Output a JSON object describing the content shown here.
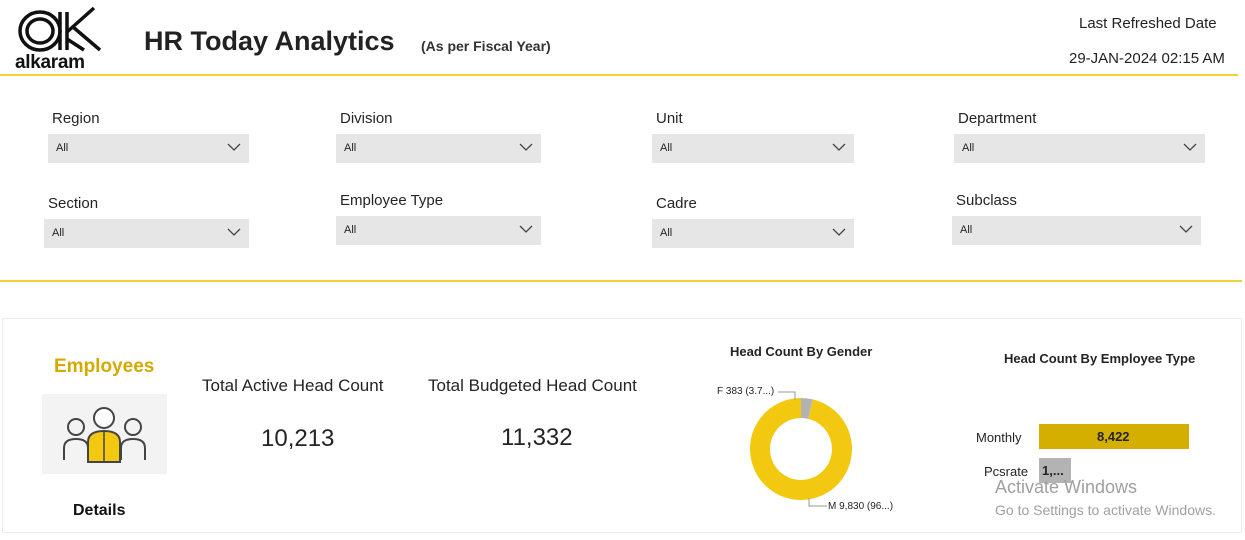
{
  "header": {
    "logo_text": "alkaram",
    "title": "HR Today Analytics",
    "subtitle": "(As per Fiscal Year)",
    "refresh_label": "Last Refreshed Date",
    "refresh_value": "29-JAN-2024 02:15 AM"
  },
  "filters": [
    {
      "label": "Region",
      "value": "All"
    },
    {
      "label": "Division",
      "value": "All"
    },
    {
      "label": "Unit",
      "value": "All"
    },
    {
      "label": "Department",
      "value": "All"
    },
    {
      "label": "Section",
      "value": "All"
    },
    {
      "label": "Employee Type",
      "value": "All"
    },
    {
      "label": "Cadre",
      "value": "All"
    },
    {
      "label": "Subclass",
      "value": "All"
    }
  ],
  "employees": {
    "title": "Employees",
    "details_label": "Details",
    "icon": "people-group-icon"
  },
  "kpis": {
    "active": {
      "label": "Total Active Head Count",
      "value": "10,213"
    },
    "budgeted": {
      "label": "Total Budgeted Head Count",
      "value": "11,332"
    }
  },
  "gender_chart": {
    "title": "Head Count By Gender",
    "label_f": "F 383 (3.7...)",
    "label_m": "M 9,830 (96...)"
  },
  "employee_type_chart": {
    "title": "Head Count By Employee Type"
  },
  "chart_data": [
    {
      "type": "pie",
      "title": "Head Count By Gender",
      "categories": [
        "F",
        "M"
      ],
      "values": [
        383,
        9830
      ],
      "colors": [
        "#b3b3b3",
        "#f2c811"
      ]
    },
    {
      "type": "bar",
      "title": "Head Count By Employee Type",
      "categories": [
        "Monthly",
        "Pcsrate"
      ],
      "values": [
        8422,
        1791
      ],
      "data_labels": [
        "8,422",
        "1,..."
      ],
      "colors": [
        "#d4af00",
        "#b3b3b3"
      ]
    }
  ],
  "watermark": {
    "line1": "Activate Windows",
    "line2": "Go to Settings to activate Windows."
  },
  "colors": {
    "accent_yellow": "#f2c811",
    "divider_yellow": "#f2cf3c",
    "dropdown_bg": "#e6e6e6",
    "employees_title": "#d4a900"
  }
}
